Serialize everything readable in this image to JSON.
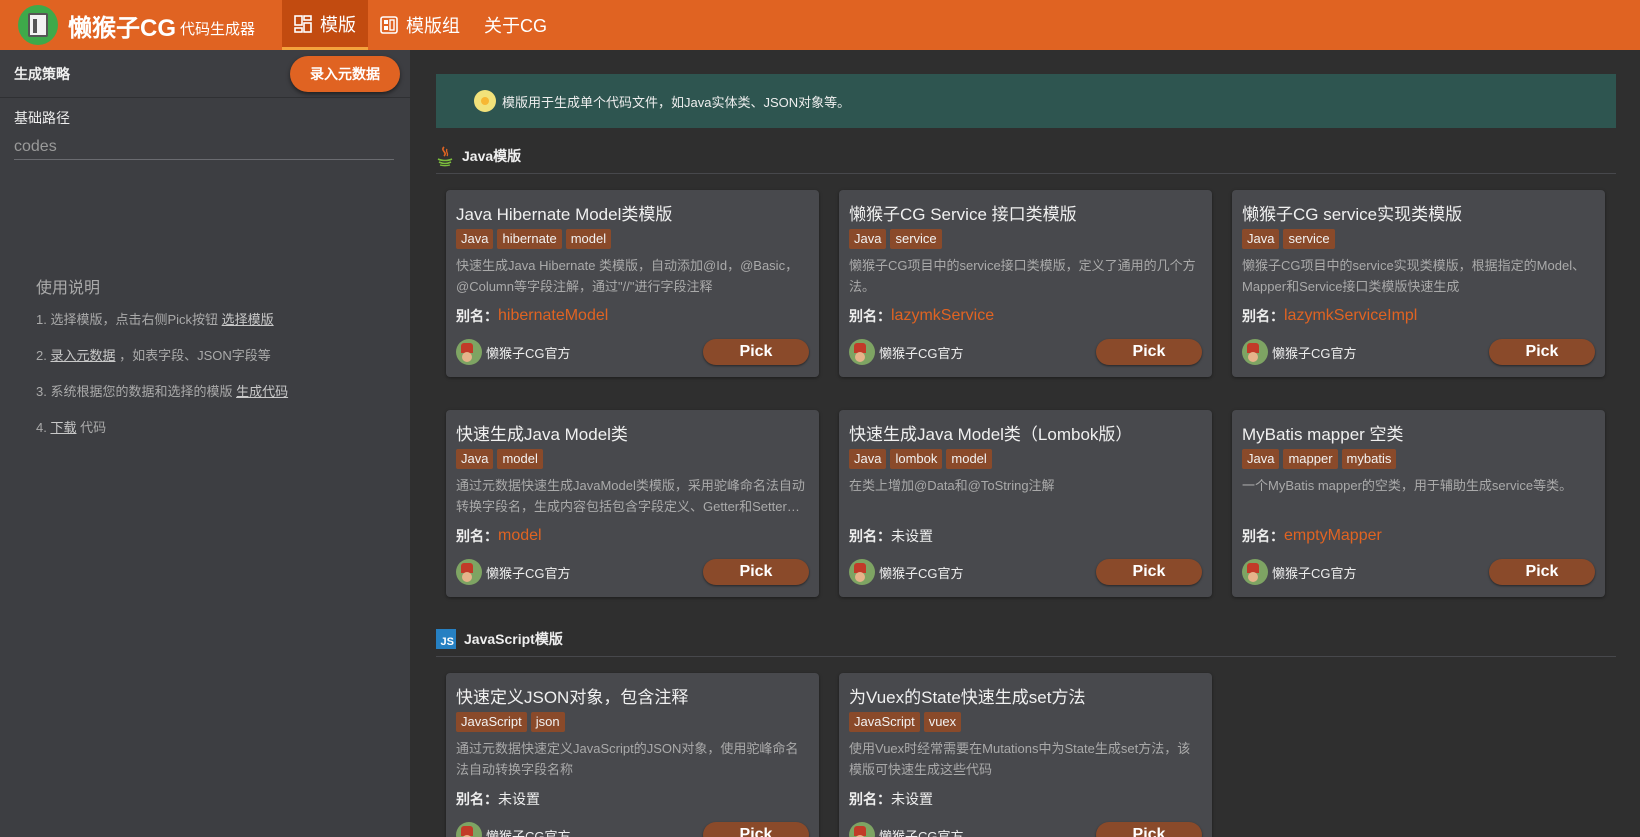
{
  "header": {
    "title": "懒猴子CG",
    "subtitle": "代码生成器",
    "nav": [
      {
        "label": "模版",
        "icon": "template-icon",
        "active": true
      },
      {
        "label": "模版组",
        "icon": "template-group-icon",
        "active": false
      },
      {
        "label": "关于CG",
        "icon": "",
        "active": false
      }
    ]
  },
  "sidebar": {
    "strategy_label": "生成策略",
    "import_button": "录入元数据",
    "base_path_label": "基础路径",
    "base_path_value": "codes",
    "usage": {
      "title": "使用说明",
      "steps": [
        {
          "prefix": "1. 选择模版，点击右侧Pick按钮 ",
          "link": "选择模版",
          "suffix": ""
        },
        {
          "prefix": "2. ",
          "link": "录入元数据",
          "suffix": " ，如表字段、JSON字段等"
        },
        {
          "prefix": "3. 系统根据您的数据和选择的模版 ",
          "link": "生成代码",
          "suffix": ""
        },
        {
          "prefix": "4. ",
          "link": "下载",
          "suffix": " 代码"
        }
      ]
    }
  },
  "main": {
    "tip": "模版用于生成单个代码文件，如Java实体类、JSON对象等。",
    "alias_label": "别名：",
    "pick_label": "Pick",
    "sections": [
      {
        "title": "Java模版",
        "icon": "java-icon",
        "cards": [
          {
            "title": "Java Hibernate Model类模版",
            "tags": [
              "Java",
              "hibernate",
              "model"
            ],
            "desc": "快速生成Java Hibernate 类模版，自动添加@Id，@Basic，@Column等字段注解，通过\"//\"进行字段注释",
            "alias": "hibernateModel",
            "author": "懒猴子CG官方"
          },
          {
            "title": "懒猴子CG Service 接口类模版",
            "tags": [
              "Java",
              "service"
            ],
            "desc": "懒猴子CG项目中的service接口类模版，定义了通用的几个方法。",
            "alias": "lazymkService",
            "author": "懒猴子CG官方"
          },
          {
            "title": "懒猴子CG service实现类模版",
            "tags": [
              "Java",
              "service"
            ],
            "desc": "懒猴子CG项目中的service实现类模版，根据指定的Model、Mapper和Service接口类模版快速生成",
            "alias": "lazymkServiceImpl",
            "author": "懒猴子CG官方"
          },
          {
            "title": "快速生成Java Model类",
            "tags": [
              "Java",
              "model"
            ],
            "desc": "通过元数据快速生成JavaModel类模版，采用驼峰命名法自动转换字段名，生成内容包括包含字段定义、Getter和Setter方法",
            "alias": "model",
            "author": "懒猴子CG官方"
          },
          {
            "title": "快速生成Java Model类（Lombok版）",
            "tags": [
              "Java",
              "lombok",
              "model"
            ],
            "desc": "在类上增加@Data和@ToString注解",
            "alias": "未设置",
            "author": "懒猴子CG官方"
          },
          {
            "title": "MyBatis mapper 空类",
            "tags": [
              "Java",
              "mapper",
              "mybatis"
            ],
            "desc": "一个MyBatis mapper的空类，用于辅助生成service等类。",
            "alias": "emptyMapper",
            "author": "懒猴子CG官方"
          }
        ]
      },
      {
        "title": "JavaScript模版",
        "icon": "javascript-icon",
        "icon_text": "JS",
        "cards": [
          {
            "title": "快速定义JSON对象，包含注释",
            "tags": [
              "JavaScript",
              "json"
            ],
            "desc": "通过元数据快速定义JavaScript的JSON对象，使用驼峰命名法自动转换字段名称",
            "alias": "未设置",
            "author": "懒猴子CG官方"
          },
          {
            "title": "为Vuex的State快速生成set方法",
            "tags": [
              "JavaScript",
              "vuex"
            ],
            "desc": "使用Vuex时经常需要在Mutations中为State生成set方法，该模版可快速生成这些代码",
            "alias": "未设置",
            "author": "懒猴子CG官方"
          }
        ]
      }
    ]
  },
  "colors": {
    "accent": "#e06322",
    "tag": "#8a4a2a",
    "tip_bg": "#2e5550"
  }
}
